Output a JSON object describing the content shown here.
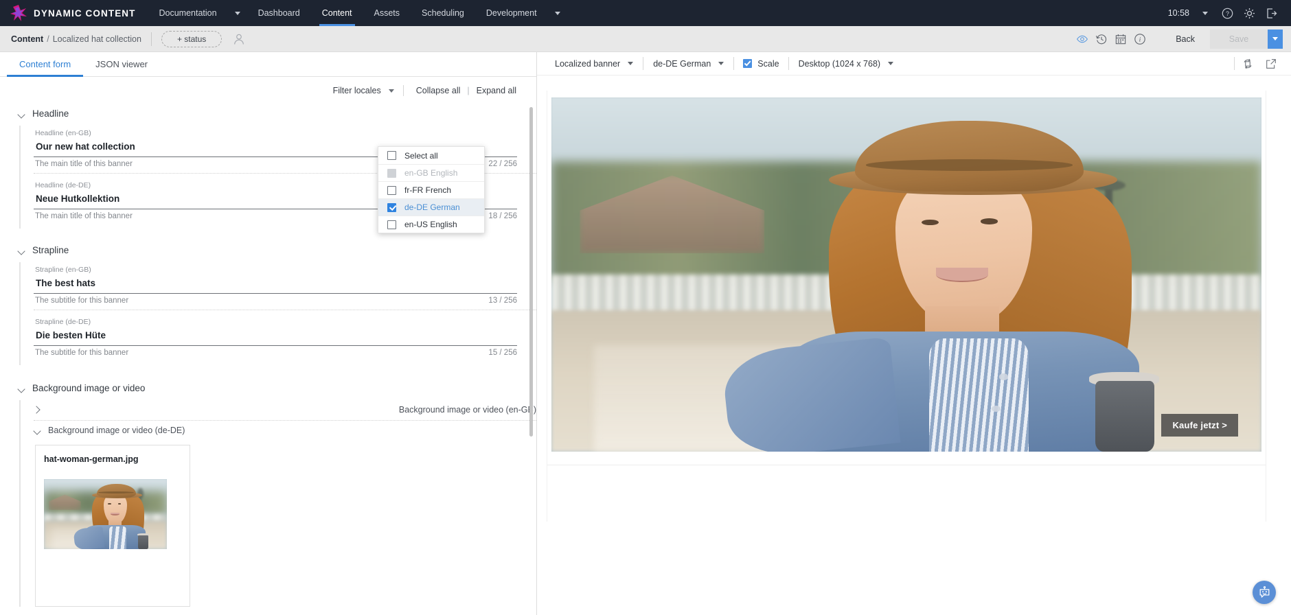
{
  "topnav": {
    "brand": "DYNAMIC CONTENT",
    "items": [
      {
        "label": "Documentation",
        "active": false,
        "has_caret": true
      },
      {
        "label": "Dashboard",
        "active": false
      },
      {
        "label": "Content",
        "active": true
      },
      {
        "label": "Assets",
        "active": false
      },
      {
        "label": "Scheduling",
        "active": false
      },
      {
        "label": "Development",
        "active": false,
        "has_caret": true
      }
    ],
    "clock": "10:58",
    "icons": [
      "chevron-down-icon",
      "help-icon",
      "settings-icon",
      "logout-icon"
    ]
  },
  "breadcrumb": {
    "root": "Content",
    "separator": "/",
    "leaf": "Localized hat collection",
    "status_button": "+ status",
    "back_label": "Back",
    "save_label": "Save",
    "icons": [
      "preview-eye-icon",
      "history-icon",
      "calendar-icon",
      "info-icon"
    ]
  },
  "tabs": [
    {
      "label": "Content form",
      "active": true
    },
    {
      "label": "JSON viewer",
      "active": false
    }
  ],
  "form_toolbar": {
    "filter_locales": "Filter locales",
    "collapse_all": "Collapse all",
    "separator": "|",
    "expand_all": "Expand all"
  },
  "locale_dropdown": {
    "open": true,
    "items": [
      {
        "label": "Select all",
        "state": "unchecked"
      },
      {
        "label": "en-GB English",
        "state": "disabled"
      },
      {
        "label": "fr-FR French",
        "state": "unchecked"
      },
      {
        "label": "de-DE German",
        "state": "checked"
      },
      {
        "label": "en-US English",
        "state": "unchecked"
      }
    ]
  },
  "sections": [
    {
      "title": "Headline",
      "expanded": true,
      "fields": [
        {
          "label": "Headline (en-GB)",
          "value": "Our new hat collection",
          "help": "The main title of this banner",
          "count": "22 / 256"
        },
        {
          "label": "Headline (de-DE)",
          "value": "Neue Hutkollektion",
          "help": "The main title of this banner",
          "count": "18 / 256"
        }
      ]
    },
    {
      "title": "Strapline",
      "expanded": true,
      "fields": [
        {
          "label": "Strapline (en-GB)",
          "value": "The best hats",
          "help": "The subtitle for this banner",
          "count": "13 / 256"
        },
        {
          "label": "Strapline (de-DE)",
          "value": "Die besten Hüte",
          "help": "The subtitle for this banner",
          "count": "15 / 256"
        }
      ]
    }
  ],
  "background_section": {
    "title": "Background image or video",
    "expanded": true,
    "subgroups": [
      {
        "label": "Background image or video (en-GB)",
        "expanded": false
      },
      {
        "label": "Background image or video (de-DE)",
        "expanded": true,
        "asset_name": "hat-woman-german.jpg"
      }
    ]
  },
  "preview_toolbar": {
    "content_type": "Localized banner",
    "locale": "de-DE German",
    "scale_label": "Scale",
    "scale_checked": true,
    "device": "Desktop (1024 x 768)",
    "icons": [
      "rotate-icon",
      "open-external-icon"
    ]
  },
  "preview": {
    "cta_label": "Kaufe jetzt >",
    "chat_icon": "chatbot-icon"
  },
  "colors": {
    "nav_bg": "#1d2431",
    "accent": "#4a90e2",
    "tab_active": "#2d7fd3",
    "crumb_bg": "#e8e8e8",
    "selected_row": "#e9eef3"
  }
}
